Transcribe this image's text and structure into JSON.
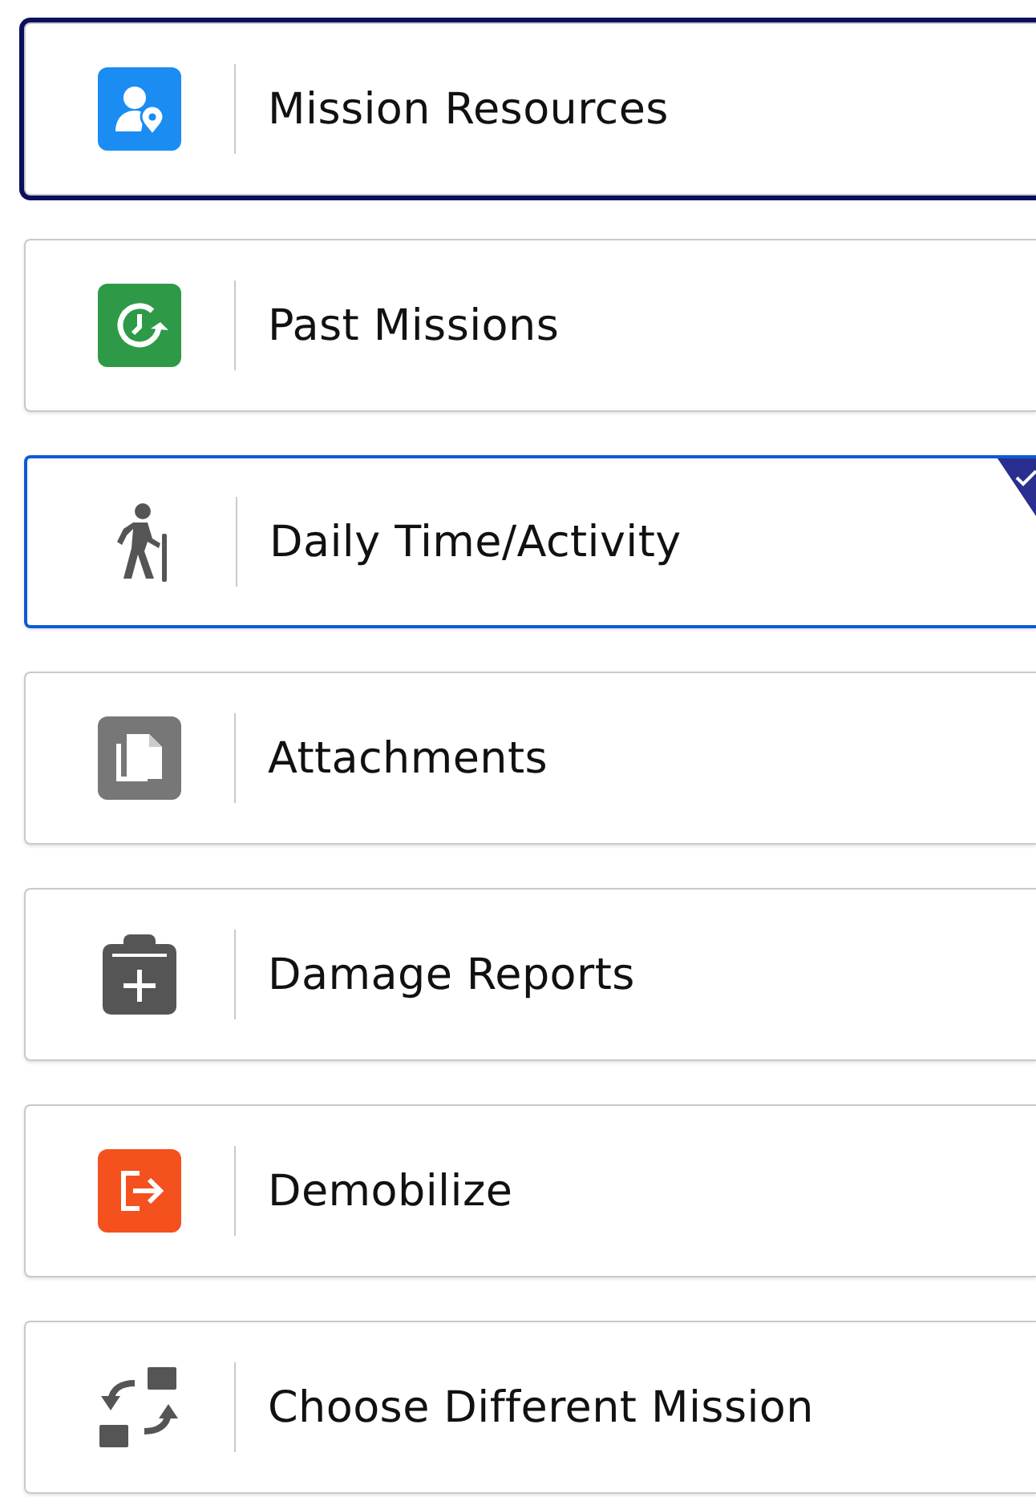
{
  "menu": [
    {
      "label": "Mission Resources",
      "selected": false,
      "focused": true
    },
    {
      "label": "Past Missions",
      "selected": false,
      "focused": false
    },
    {
      "label": "Daily Time/Activity",
      "selected": true,
      "focused": false
    },
    {
      "label": "Attachments",
      "selected": false,
      "focused": false
    },
    {
      "label": "Damage Reports",
      "selected": false,
      "focused": false
    },
    {
      "label": "Demobilize",
      "selected": false,
      "focused": false
    },
    {
      "label": "Choose Different Mission",
      "selected": false,
      "focused": false
    }
  ]
}
